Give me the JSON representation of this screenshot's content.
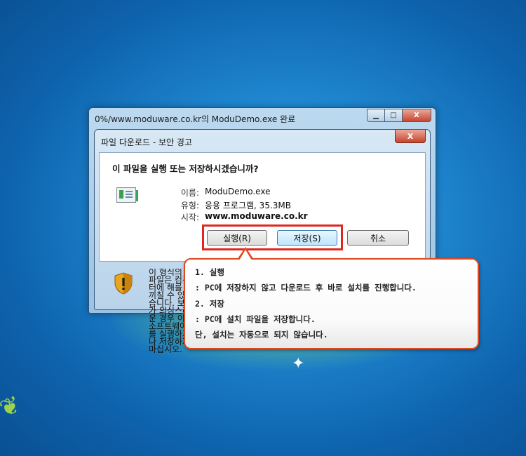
{
  "outer_window": {
    "title": "0%/www.moduware.co.kr의 ModuDemo.exe  완료",
    "minimize_glyph": "▁",
    "maximize_glyph": "□",
    "close_glyph": "X"
  },
  "dialog": {
    "title": "파일 다운로드 - 보안 경고",
    "close_glyph": "X",
    "question": "이 파일을 실행 또는 저장하시겠습니까?",
    "fields": [
      {
        "label": "이름:",
        "value": "ModuDemo.exe"
      },
      {
        "label": "유형:",
        "value": "응용 프로그램, 35.3MB"
      },
      {
        "label": "시작:",
        "value": "www.moduware.co.kr"
      }
    ],
    "buttons": {
      "run": "실행(R)",
      "save": "저장(S)",
      "cancel": "취소"
    },
    "warning_text_partial": "이 형식의 파일은 컴퓨터에 해를 끼칠 수 있습니다. 보가 의심스러운 경우 이 소프트웨어를 실행하거나 저장하지 마십시오."
  },
  "callout": {
    "lines": [
      "1. 실행",
      "  : PC에 저장하지 않고 다운로드 후 바로 설치를 진행합니다.",
      "2. 저장",
      "  : PC에 설치 파일을 저장합니다.",
      "    단, 설치는 자동으로 되지 않습니다."
    ]
  },
  "colors": {
    "highlight_border": "#e0261f",
    "callout_border": "#e0491f"
  }
}
